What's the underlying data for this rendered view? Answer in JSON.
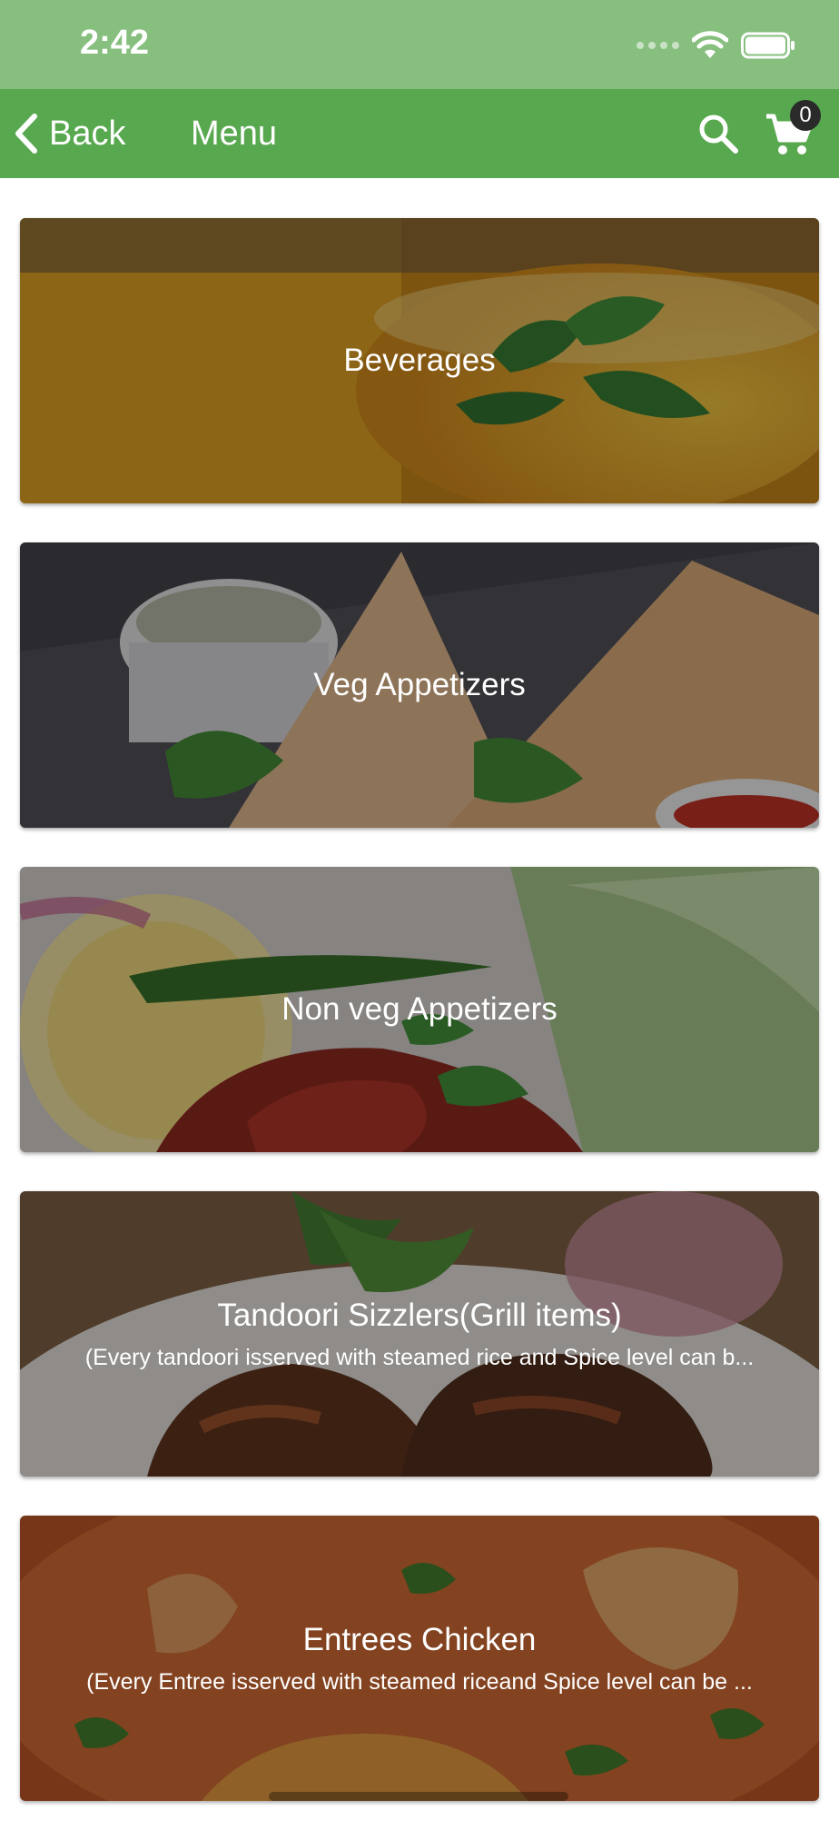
{
  "status_bar": {
    "time": "2:42",
    "icons": [
      "signal-icon",
      "wifi-icon",
      "battery-icon"
    ]
  },
  "header": {
    "back_label": "Back",
    "title": "Menu",
    "cart_count": "0",
    "icons": [
      "chevron-left-icon",
      "search-icon",
      "cart-icon"
    ]
  },
  "colors": {
    "status_bar": "#87bf7f",
    "app_bar": "#58a84f",
    "badge": "#2a2a2a"
  },
  "categories": [
    {
      "title": "Beverages",
      "description": ""
    },
    {
      "title": "Veg Appetizers",
      "description": ""
    },
    {
      "title": "Non veg Appetizers",
      "description": ""
    },
    {
      "title": "Tandoori Sizzlers(Grill items)",
      "description": "(Every tandoori isserved with steamed rice and Spice level can b..."
    },
    {
      "title": "Entrees Chicken",
      "description": "(Every Entree isserved with steamed riceand Spice level can be ..."
    }
  ]
}
